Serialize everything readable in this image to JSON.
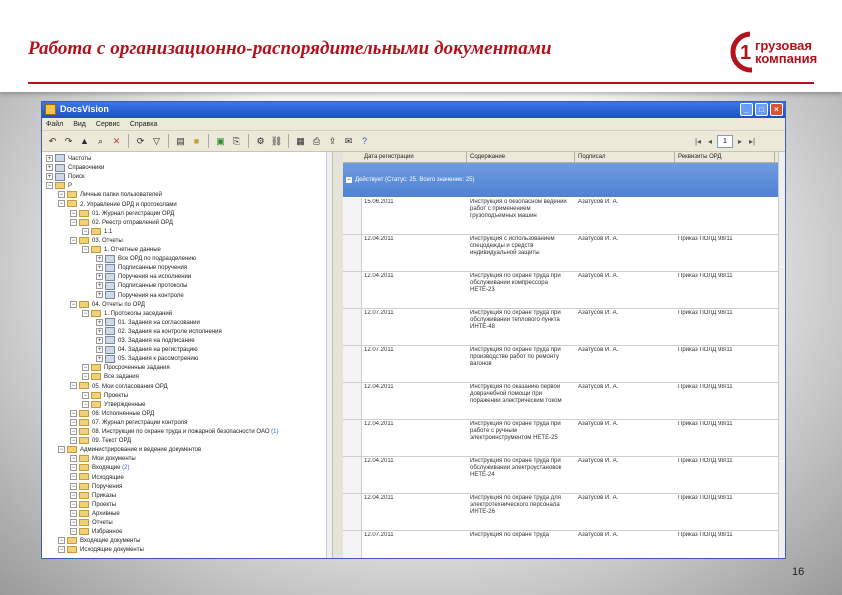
{
  "slide": {
    "title": "Работа с организационно-распорядительными документами",
    "page_number": "16",
    "accent_color": "#b1121b"
  },
  "logo": {
    "line1": "грузовая",
    "line2": "компания",
    "mark_digit": "1"
  },
  "window": {
    "title": "DocsVision",
    "menu": [
      "Файл",
      "Вид",
      "Сервис",
      "Справка"
    ]
  },
  "toolbar": {
    "page_value": "1"
  },
  "tree": [
    {
      "label": "Частоты",
      "level": 0,
      "type": "doc"
    },
    {
      "label": "Справочники",
      "level": 0,
      "type": "doc"
    },
    {
      "label": "Поиск",
      "level": 0,
      "type": "doc"
    },
    {
      "label": "P",
      "level": 0,
      "type": "folder"
    },
    {
      "label": "Личные папки пользователей",
      "level": 1,
      "type": "folder"
    },
    {
      "label": "2. Управление ОРД и протоколами",
      "level": 1,
      "type": "folder"
    },
    {
      "label": "01. Журнал регистрации ОРД",
      "level": 2,
      "type": "folder"
    },
    {
      "label": "02. Реестр отправлений ОРД",
      "level": 2,
      "type": "folder"
    },
    {
      "label": "1.1",
      "level": 3,
      "type": "folder"
    },
    {
      "label": "03. Отчеты",
      "level": 2,
      "type": "folder"
    },
    {
      "label": "1. Отчетные данные",
      "level": 3,
      "type": "folder"
    },
    {
      "label": "Все ОРД по подразделению",
      "level": 4,
      "type": "doc"
    },
    {
      "label": "Подписанные поручения",
      "level": 4,
      "type": "doc"
    },
    {
      "label": "Поручения на исполнении",
      "level": 4,
      "type": "doc"
    },
    {
      "label": "Подписанные протоколы",
      "level": 4,
      "type": "doc"
    },
    {
      "label": "Поручения на контроле",
      "level": 4,
      "type": "doc"
    },
    {
      "label": "04. Отчеты по ОРД",
      "level": 2,
      "type": "folder"
    },
    {
      "label": "1. Протоколы заседаний",
      "level": 3,
      "type": "folder"
    },
    {
      "label": "01. Задания на согласовании",
      "level": 4,
      "type": "doc"
    },
    {
      "label": "02. Задания на контроле исполнения",
      "level": 4,
      "type": "doc"
    },
    {
      "label": "03. Задания на подписание",
      "level": 4,
      "type": "doc"
    },
    {
      "label": "04. Задания на регистрацию",
      "level": 4,
      "type": "doc"
    },
    {
      "label": "05. Задания к рассмотрению",
      "level": 4,
      "type": "doc"
    },
    {
      "label": "Просроченные задания",
      "level": 3,
      "type": "folder"
    },
    {
      "label": "Все задания",
      "level": 3,
      "type": "folder"
    },
    {
      "label": "05. Мои согласования ОРД",
      "level": 2,
      "type": "folder"
    },
    {
      "label": "Проекты",
      "level": 3,
      "type": "folder"
    },
    {
      "label": "Утвержденные",
      "level": 3,
      "type": "folder"
    },
    {
      "label": "06. Исполненные ОРД",
      "level": 2,
      "type": "folder"
    },
    {
      "label": "07. Журнал регистрации контроля",
      "level": 2,
      "type": "folder"
    },
    {
      "label": "08. Инструкции по охране труда и пожарной безопасности ОАО",
      "level": 2,
      "type": "folder",
      "count": "(1)"
    },
    {
      "label": "09. Текст ОРД",
      "level": 2,
      "type": "folder"
    },
    {
      "label": "Администрирование и ведение документов",
      "level": 1,
      "type": "folder"
    },
    {
      "label": "Мои документы",
      "level": 2,
      "type": "folder"
    },
    {
      "label": "Входящие",
      "level": 2,
      "type": "folder",
      "count": "(2)"
    },
    {
      "label": "Исходящие",
      "level": 2,
      "type": "folder"
    },
    {
      "label": "Поручения",
      "level": 2,
      "type": "folder"
    },
    {
      "label": "Приказы",
      "level": 2,
      "type": "folder"
    },
    {
      "label": "Проекты",
      "level": 2,
      "type": "folder"
    },
    {
      "label": "Архивные",
      "level": 2,
      "type": "folder"
    },
    {
      "label": "Отчеты",
      "level": 2,
      "type": "folder"
    },
    {
      "label": "Избранное",
      "level": 2,
      "type": "folder"
    },
    {
      "label": "Входящие документы",
      "level": 1,
      "type": "folder"
    },
    {
      "label": "Исходящие документы",
      "level": 1,
      "type": "folder"
    }
  ],
  "grid": {
    "columns": [
      "Дата регистрации",
      "Содержание",
      "Подписал",
      "Реквизиты ОРД"
    ],
    "group_label": "Действует (Статус: 25. Всего значение: 25)",
    "rows": [
      {
        "date": "15.06.2011",
        "content": "Инструкция о безопасном ведении работ с применением грузоподъемных машин",
        "signer": "Азатусов И. А.",
        "ref": ""
      },
      {
        "date": "12.04.2011",
        "content": "Инструкция с использованием спецодежды и средств индивидуальной защиты",
        "signer": "Азатусов И. А.",
        "ref": "Приказ ПОЛД 98/11"
      },
      {
        "date": "12.04.2011",
        "content": "Инструкция по охране труда при обслуживании компрессора НЕТЕ-23",
        "signer": "Азатусов И. А.",
        "ref": "Приказ ПОЛД 98/11"
      },
      {
        "date": "12.07.2011",
        "content": "Инструкция по охране труда при обслуживании теплового пункта ИНТЕ-48",
        "signer": "Азатусов И. А.",
        "ref": "Приказ ПОЛД 98/11"
      },
      {
        "date": "12.07.2011",
        "content": "Инструкция по охране труда при производстве работ по ремонту вагонов",
        "signer": "Азатусов И. А.",
        "ref": "Приказ ПОЛД 98/11"
      },
      {
        "date": "12.04.2011",
        "content": "Инструкция по оказанию первой доврачебной помощи при поражении электрическим током",
        "signer": "Азатусов И. А.",
        "ref": "Приказ ПОЛД 98/11"
      },
      {
        "date": "12.04.2011",
        "content": "Инструкция по охране труда при работе с ручным электроинструментом НЕТЕ-25",
        "signer": "Азатусов И. А.",
        "ref": "Приказ ПОЛД 98/11"
      },
      {
        "date": "12.04.2011",
        "content": "Инструкция по охране труда при обслуживании электроустановок НЕТЕ-24",
        "signer": "Азатусов И. А.",
        "ref": "Приказ ПОЛД 98/11"
      },
      {
        "date": "12.04.2011",
        "content": "Инструкция по охране труда для электротехнического персонала ИНТЕ-26",
        "signer": "Азатусов И. А.",
        "ref": "Приказ ПОЛД 98/11"
      },
      {
        "date": "12.07.2011",
        "content": "Инструкция по охране труда",
        "signer": "Азатусов И. А.",
        "ref": "Приказ ПОЛД 98/11"
      }
    ]
  }
}
